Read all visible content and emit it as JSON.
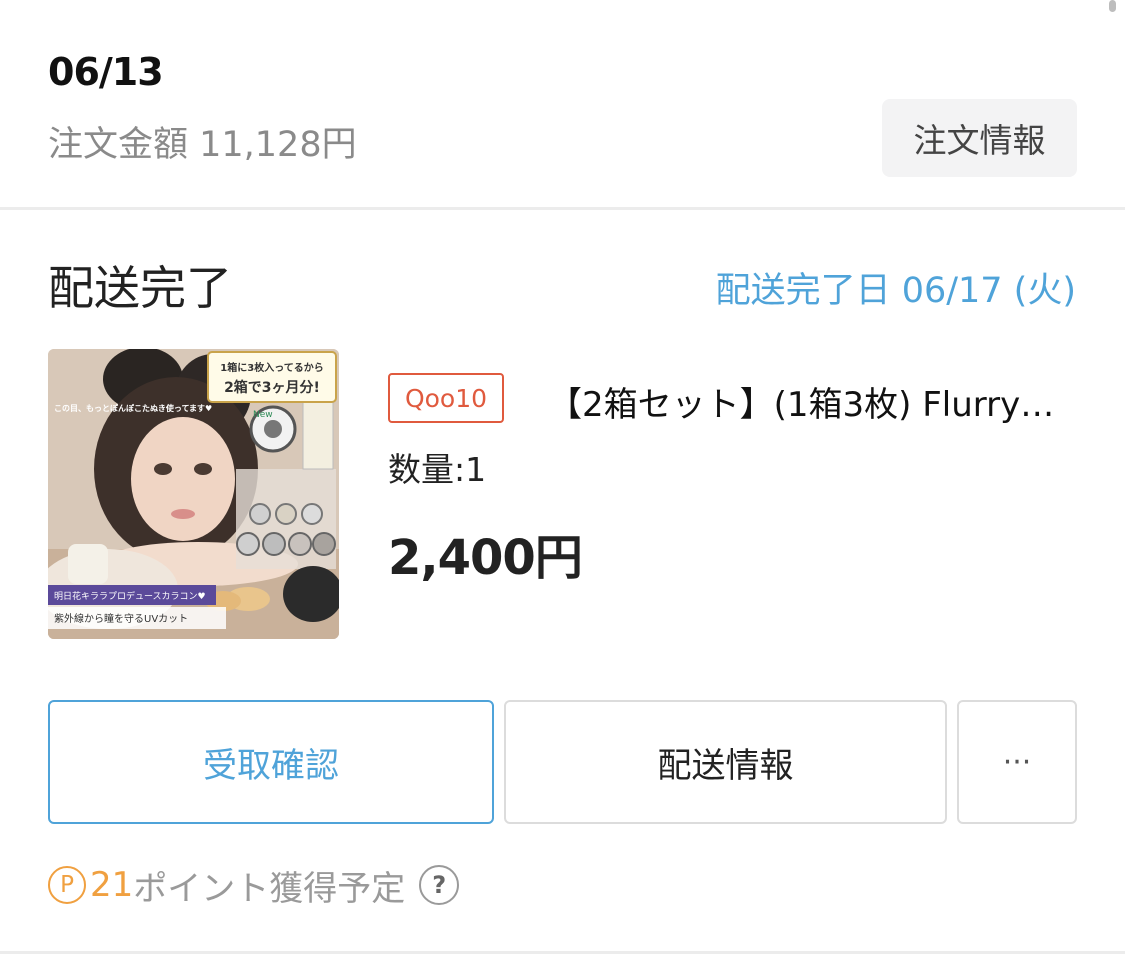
{
  "order": {
    "date": "06/13",
    "amount": "注文金額 11,128円",
    "info_button": "注文情報"
  },
  "delivery": {
    "status": "配送完了",
    "completed_date": "配送完了日 06/17 (火)"
  },
  "product": {
    "shop_badge": "Qoo10",
    "title": "【2箱セット】(1箱3枚) Flurry…",
    "quantity": "数量:1",
    "price": "2,400円",
    "image": {
      "banner_top": "1箱に3枚入ってるから",
      "banner_bottom": "2箱で3ヶ月分!",
      "tagline": "この目、もっとぽんぽこたぬき使ってます♥",
      "badge_new": "New",
      "label_producer": "明日花キララプロデュースカラコン♥",
      "label_uv": "紫外線から瞳を守るUVカット"
    }
  },
  "actions": {
    "receive": "受取確認",
    "shipping": "配送情報",
    "more": "···"
  },
  "points": {
    "icon_letter": "P",
    "count": "21",
    "label": "ポイント獲得予定",
    "help": "?"
  },
  "colors": {
    "accent_blue": "#4fa3d9",
    "qoo10_red": "#e05a3e",
    "point_orange": "#f0a040",
    "muted_gray": "#8a8a8a"
  }
}
